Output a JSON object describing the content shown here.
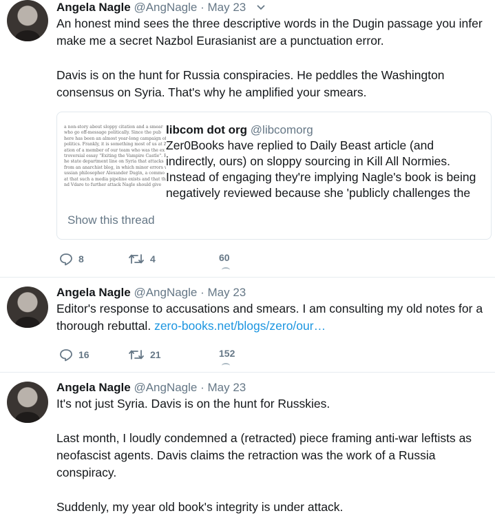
{
  "tweets": [
    {
      "name": "Angela Nagle",
      "handle": "@AngNagle",
      "dot": "·",
      "date": "May 23",
      "paragraphs": [
        "An honest mind sees the three descriptive words in the Dugin passage you infer make me a secret Nazbol Eurasianist are a punctuation error.",
        "Davis is on the hunt for Russia conspiracies. He peddles the Washington consensus on Syria. That's why he amplified your smears."
      ],
      "quote": {
        "name": "libcom dot org",
        "handle": "@libcomorg",
        "text": "Zer0Books have replied to Daily Beast article (and indirectly, ours) on sloppy sourcing in Kill All Normies. Instead of engaging they're implying Nagle's book is being negatively reviewed because she 'publicly challenges the",
        "show_thread": "Show this thread",
        "thumb_lines": [
          "a non-story about sloppy citation and a smear",
          "who go off-message politically. Since the pub",
          "here has been an almost year-long campaign of",
          "politics. Frankly, it is something most of us at Z",
          "ation of a member of our team who was the ex",
          "troversial essay \"Exiting the Vampire Castle\". E",
          "he state department line on Syria that attacks",
          "from an anarchist blog, in which minor errors w",
          "ussian philosopher Alexander Dugin, a commo",
          "at that such a media pipeline exists and that th",
          "nd Vdare to further attack Nagle should give"
        ]
      },
      "replies": "8",
      "retweets": "4",
      "likes": "60"
    },
    {
      "name": "Angela Nagle",
      "handle": "@AngNagle",
      "dot": "·",
      "date": "May 23",
      "text": "Editor's response to accusations and smears. I am consulting my old notes for a thorough rebuttal.",
      "link": "zero-books.net/blogs/zero/our…",
      "replies": "16",
      "retweets": "21",
      "likes": "152"
    },
    {
      "name": "Angela Nagle",
      "handle": "@AngNagle",
      "dot": "·",
      "date": "May 23",
      "paragraphs": [
        "It's not just Syria. Davis is on the hunt for Russkies.",
        "Last month, I loudly condemned a (retracted) piece framing anti-war leftists as neofascist agents. Davis claims the retraction was the work of a Russia conspiracy.",
        "Suddenly, my year old book's integrity is under attack."
      ]
    }
  ],
  "icons": {
    "reply": "reply-icon",
    "retweet": "retweet-icon",
    "chevron": "chevron-down-icon"
  },
  "colors": {
    "link": "#1b95e0",
    "secondary": "#657786",
    "border": "#e6ecf0"
  }
}
